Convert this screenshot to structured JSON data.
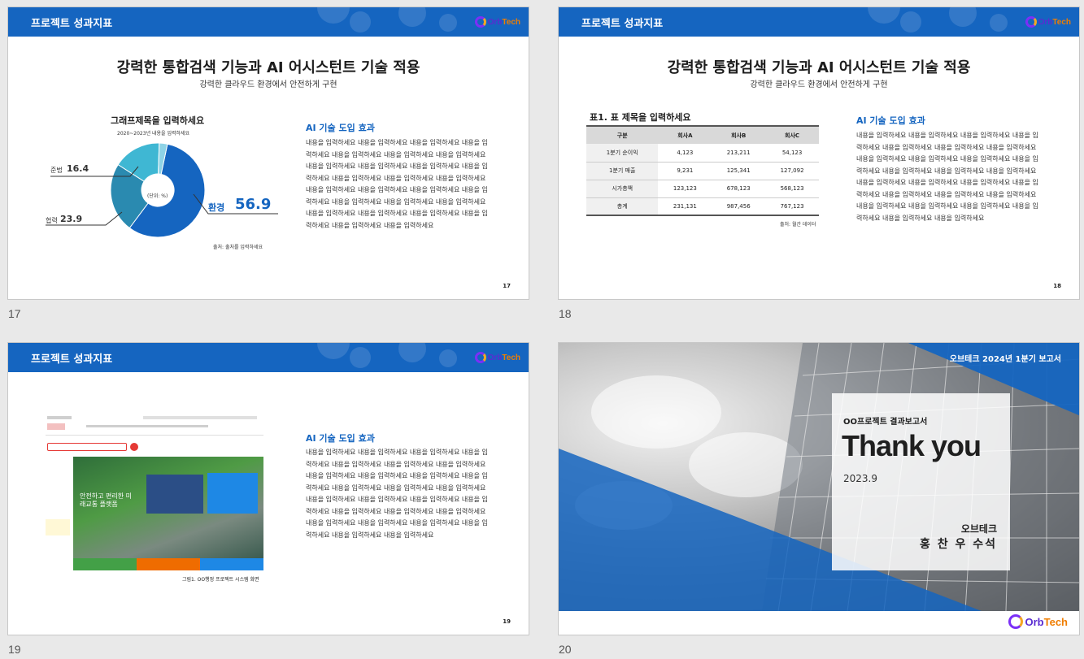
{
  "slides": [
    {
      "number": "17",
      "header_title": "프로젝트 성과지표",
      "logo_text": "Orb",
      "logo_text2": "Tech",
      "title": "강력한 통합검색 기능과 AI 어시스턴트 기술 적용",
      "subtitle": "강력한 클라우드 환경에서 안전하게 구현",
      "graph_title": "그래프제목을 입력하세요",
      "graph_subtitle": "2020~2023년 내용을 입력하세요",
      "donut_center": "(단위: %)",
      "labels": {
        "a_name": "준법",
        "a_value": "16.4",
        "b_name": "협력",
        "b_value": "23.9",
        "c_name": "환경",
        "c_value": "56.9"
      },
      "source": "출처: 출처를 입력하세요",
      "ai_heading": "AI 기술 도입 효과",
      "ai_body": "내용을 입력하세요 내용을 입력하세요 내용을 입력하세요 내용을 입력하세요 내용을 입력하세요 내용을 입력하세요 내용을 입력하세요 내용을 입력하세요 내용을 입력하세요 내용을 입력하세요 내용을 입력하세요 내용을 입력하세요 내용을 입력하세요 내용을 입력하세요 내용을 입력하세요 내용을 입력하세요 내용을 입력하세요 내용을 입력하세요 내용을 입력하세요 내용을 입력하세요 내용을 입력하세요 내용을 입력하세요 내용을 입력하세요 내용을 입력하세요 내용을 입력하세요 내용을 입력하세요 내용을 입력하세요",
      "page": "17"
    },
    {
      "number": "18",
      "header_title": "프로젝트 성과지표",
      "logo_text": "Orb",
      "logo_text2": "Tech",
      "title": "강력한 통합검색 기능과 AI 어시스턴트 기술 적용",
      "subtitle": "강력한 클라우드 환경에서 안전하게 구현",
      "table_title": "표1. 표 제목을 입력하세요",
      "table": {
        "headers": [
          "구분",
          "회사A",
          "회사B",
          "회사C"
        ],
        "rows": [
          [
            "1분기 순이익",
            "4,123",
            "213,211",
            "54,123"
          ],
          [
            "1분기 매출",
            "9,231",
            "125,341",
            "127,092"
          ],
          [
            "시가총액",
            "123,123",
            "678,123",
            "568,123"
          ],
          [
            "총계",
            "231,131",
            "987,456",
            "767,123"
          ]
        ]
      },
      "source": "출처: 월간 데이터",
      "ai_heading": "AI 기술 도입 효과",
      "ai_body": "내용을 입력하세요 내용을 입력하세요 내용을 입력하세요 내용을 입력하세요 내용을 입력하세요 내용을 입력하세요 내용을 입력하세요 내용을 입력하세요 내용을 입력하세요 내용을 입력하세요 내용을 입력하세요 내용을 입력하세요 내용을 입력하세요 내용을 입력하세요 내용을 입력하세요 내용을 입력하세요 내용을 입력하세요 내용을 입력하세요 내용을 입력하세요 내용을 입력하세요 내용을 입력하세요 내용을 입력하세요 내용을 입력하세요 내용을 입력하세요 내용을 입력하세요 내용을 입력하세요 내용을 입력하세요",
      "page": "18"
    },
    {
      "number": "19",
      "header_title": "프로젝트 성과지표",
      "logo_text": "Orb",
      "logo_text2": "Tech",
      "hero_text": "안전하고 편리한 미래교통 플랫폼",
      "caption": "그림1. OO행정 프로젝트 시스템 화면",
      "ai_heading": "AI 기술 도입 효과",
      "ai_body": "내용을 입력하세요 내용을 입력하세요 내용을 입력하세요 내용을 입력하세요 내용을 입력하세요 내용을 입력하세요 내용을 입력하세요 내용을 입력하세요 내용을 입력하세요 내용을 입력하세요 내용을 입력하세요 내용을 입력하세요 내용을 입력하세요 내용을 입력하세요 내용을 입력하세요 내용을 입력하세요 내용을 입력하세요 내용을 입력하세요 내용을 입력하세요 내용을 입력하세요 내용을 입력하세요 내용을 입력하세요 내용을 입력하세요 내용을 입력하세요 내용을 입력하세요 내용을 입력하세요 내용을 입력하세요",
      "page": "19"
    },
    {
      "number": "20",
      "report": "오브테크 2024년 1분기 보고서",
      "project": "OO프로젝트 결과보고서",
      "thanks": "Thank you",
      "date": "2023.9",
      "company": "오브테크",
      "name": "홍 찬 우 수석",
      "logo_text": "Orb",
      "logo_text2": "Tech"
    }
  ],
  "colors": {
    "brand": "#1565c0",
    "accent": "#f07d00"
  },
  "chart_data": {
    "type": "pie",
    "title": "그래프제목을 입력하세요",
    "subtitle": "2020~2023년 내용을 입력하세요",
    "unit": "(단위: %)",
    "categories": [
      "환경",
      "협력",
      "준법"
    ],
    "values": [
      56.9,
      23.9,
      16.4
    ]
  }
}
